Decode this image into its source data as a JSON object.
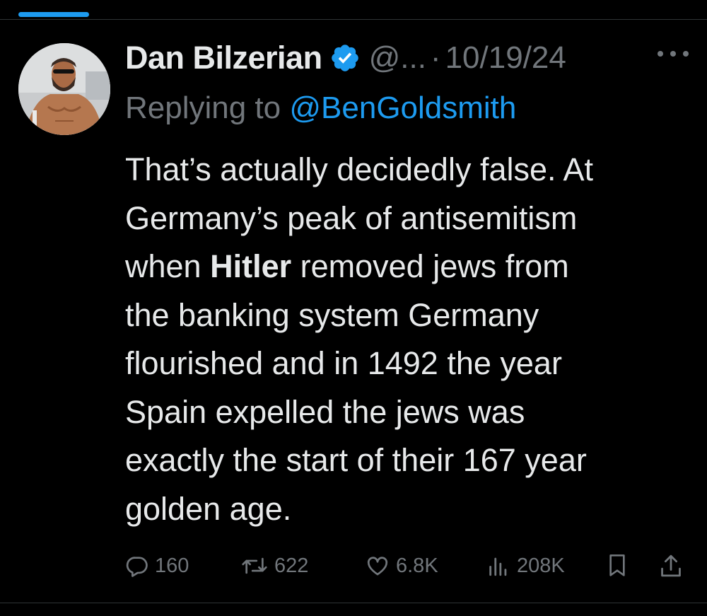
{
  "tweet": {
    "display_name": "Dan Bilzerian",
    "verified": true,
    "handle": "@...",
    "separator": "·",
    "date": "10/19/24",
    "reply_prefix": "Replying to ",
    "reply_to": "@BenGoldsmith",
    "body_lines": [
      {
        "before": "That’s actually decidedly false. At",
        "bold": "",
        "after": ""
      },
      {
        "before": "Germany’s peak of antisemitism",
        "bold": "",
        "after": ""
      },
      {
        "before": "when ",
        "bold": "Hitler",
        "after": " removed jews from"
      },
      {
        "before": "the banking system Germany",
        "bold": "",
        "after": ""
      },
      {
        "before": "flourished and in 1492 the year",
        "bold": "",
        "after": ""
      },
      {
        "before": "Spain expelled the jews was",
        "bold": "",
        "after": ""
      },
      {
        "before": "exactly the start of their 167 year",
        "bold": "",
        "after": ""
      },
      {
        "before": "golden age.",
        "bold": "",
        "after": ""
      }
    ]
  },
  "actions": {
    "replies": "160",
    "reposts": "622",
    "likes": "6.8K",
    "views": "208K"
  },
  "icons": {
    "reply": "reply-icon",
    "repost": "repost-icon",
    "like": "heart-icon",
    "views": "views-icon",
    "bookmark": "bookmark-icon",
    "share": "share-icon",
    "more": "more-icon",
    "verified": "verified-badge-icon"
  },
  "colors": {
    "background": "#000000",
    "text_primary": "#e7e9ea",
    "text_secondary": "#71767b",
    "accent": "#1d9bf0"
  }
}
